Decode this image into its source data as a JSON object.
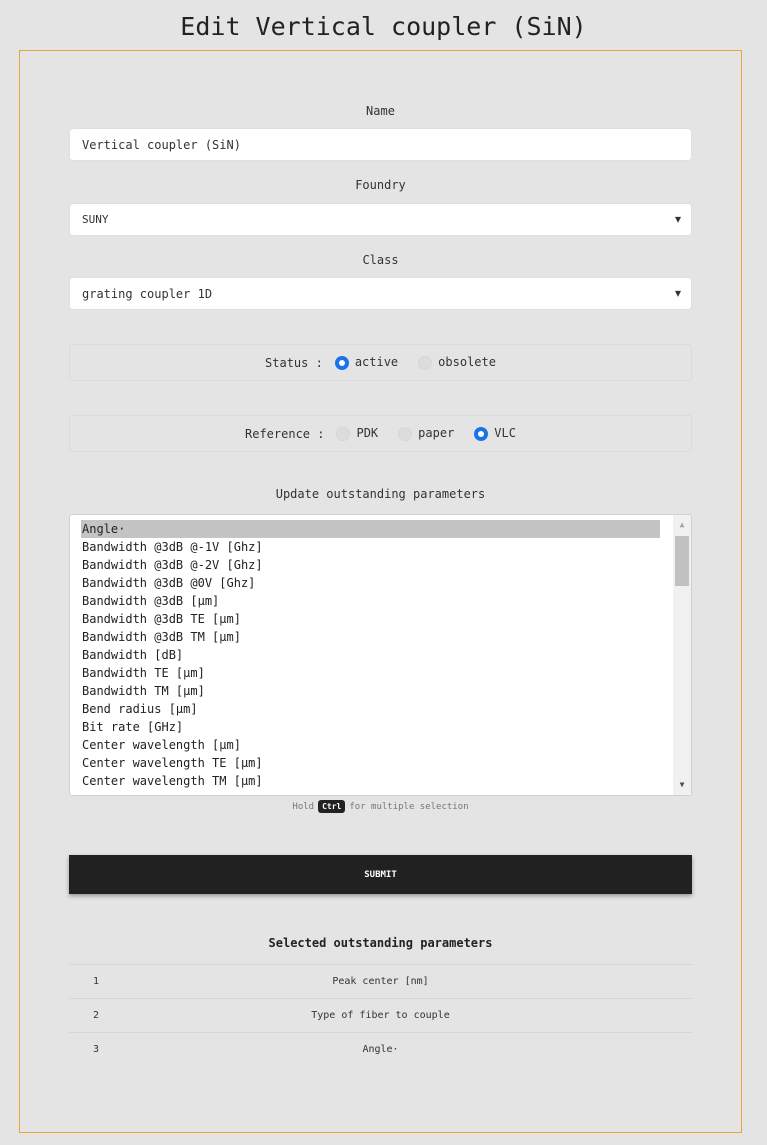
{
  "page_title": "Edit Vertical coupler (SiN)",
  "name": {
    "label": "Name",
    "value": "Vertical coupler (SiN)"
  },
  "foundry": {
    "label": "Foundry",
    "value": "SUNY"
  },
  "class": {
    "label": "Class",
    "value": "grating coupler 1D"
  },
  "status": {
    "label": "Status :",
    "options": [
      {
        "label": "active",
        "checked": true
      },
      {
        "label": "obsolete",
        "checked": false
      }
    ]
  },
  "reference": {
    "label": "Reference :",
    "options": [
      {
        "label": "PDK",
        "checked": false
      },
      {
        "label": "paper",
        "checked": false
      },
      {
        "label": "VLC",
        "checked": true
      }
    ]
  },
  "parameters": {
    "label": "Update outstanding parameters",
    "items": [
      "Angle·",
      "Bandwidth @3dB @-1V [Ghz]",
      "Bandwidth @3dB @-2V [Ghz]",
      "Bandwidth @3dB @0V [Ghz]",
      "Bandwidth @3dB [µm]",
      "Bandwidth @3dB TE [µm]",
      "Bandwidth @3dB TM [µm]",
      "Bandwidth [dB]",
      "Bandwidth TE [µm]",
      "Bandwidth TM [µm]",
      "Bend radius [µm]",
      "Bit rate [GHz]",
      "Center wavelength [µm]",
      "Center wavelength TE [µm]",
      "Center wavelength TM [µm]"
    ],
    "selected_index": 0,
    "hint_before": "Hold",
    "hint_key": "Ctrl",
    "hint_after": "for multiple selection"
  },
  "submit_label": "SUBMIT",
  "selected": {
    "title": "Selected outstanding parameters",
    "rows": [
      {
        "num": "1",
        "name": "Peak center [nm]"
      },
      {
        "num": "2",
        "name": "Type of fiber to couple"
      },
      {
        "num": "3",
        "name": "Angle·"
      }
    ]
  },
  "colors": {
    "accent_border": "#f0a23a",
    "radio": "#1a73e8",
    "button": "#212121"
  }
}
